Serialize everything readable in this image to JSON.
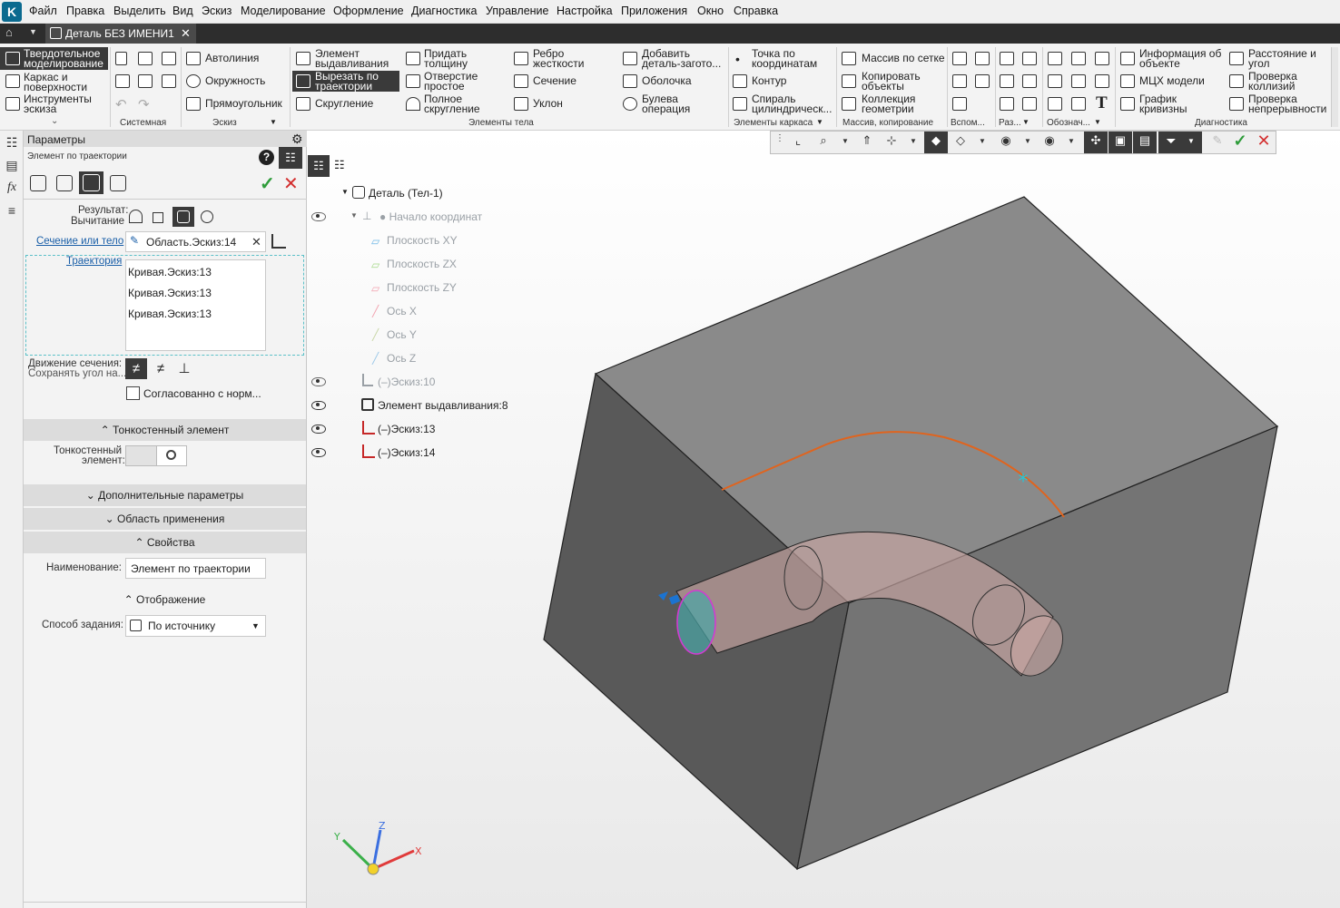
{
  "menu": [
    "Файл",
    "Правка",
    "Выделить",
    "Вид",
    "Эскиз",
    "Моделирование",
    "Оформление",
    "Диагностика",
    "Управление",
    "Настройка",
    "Приложения",
    "Окно",
    "Справка"
  ],
  "document_tab": "Деталь БЕЗ ИМЕНИ1",
  "ribbon": {
    "modes": [
      "Твердотельное моделирование",
      "Каркас и поверхности",
      "Инструменты эскиза"
    ],
    "sketch": [
      "Автолиния",
      "Окружность",
      "Прямоугольник"
    ],
    "body1": [
      "Элемент выдавливания",
      "Вырезать по траектории",
      "Скругление"
    ],
    "body2": [
      "Придать толщину",
      "Отверстие простое",
      "Полное скругление"
    ],
    "body3": [
      "Ребро жесткости",
      "Сечение",
      "Уклон"
    ],
    "body4": [
      "Добавить деталь-загото...",
      "Оболочка",
      "Булева операция"
    ],
    "frame": [
      "Точка по координатам",
      "Контур",
      "Спираль цилиндрическ..."
    ],
    "array": [
      "Массив по сетке",
      "Копировать объекты",
      "Коллекция геометрии"
    ],
    "info": [
      "Информация об объекте",
      "МЦХ модели",
      "График кривизны"
    ],
    "check": [
      "Расстояние и угол",
      "Проверка коллизий",
      "Проверка непрерывности"
    ],
    "groups": [
      "Системная",
      "Эскиз",
      "Элементы тела",
      "Элементы каркаса",
      "Массив, копирование",
      "Вспом...",
      "Раз...",
      "Обознач...",
      "Диагностика"
    ]
  },
  "panel": {
    "title": "Параметры",
    "subtitle": "Элемент по траектории",
    "result_label": "Результат:",
    "result_value": "Вычитание",
    "section_label": "Сечение или тело",
    "section_value": "Область.Эскиз:14",
    "trajectory_label": "Траектория",
    "trajectory_items": [
      "Кривая.Эскиз:13",
      "Кривая.Эскиз:13",
      "Кривая.Эскиз:13"
    ],
    "motion_label": "Движение сечения:",
    "motion_value": "Сохранять угол на...",
    "checkbox_label": "Согласованно с норм...",
    "thin_section": "Тонкостенный элемент",
    "thin_label_1": "Тонкостенный",
    "thin_label_2": "элемент:",
    "extra_section": "Дополнительные параметры",
    "scope_section": "Область применения",
    "props_section": "Свойства",
    "name_label": "Наименование:",
    "name_value": "Элемент по траектории",
    "display_section": "Отображение",
    "method_label": "Способ задания:",
    "method_value": "По источнику"
  },
  "tree": {
    "root": "Деталь (Тел-1)",
    "origin": "Начало координат",
    "planes": [
      "Плоскость XY",
      "Плоскость ZX",
      "Плоскость ZY"
    ],
    "axes": [
      "Ось X",
      "Ось Y",
      "Ось Z"
    ],
    "items": [
      "Эскиз:10",
      "Элемент выдавливания:8",
      "Эскиз:13",
      "Эскиз:14"
    ]
  },
  "axes_labels": {
    "x": "X",
    "y": "Y",
    "z": "Z"
  },
  "colors": {
    "accent": "#e0641e",
    "ok": "#2e9c3a",
    "cancel": "#d32f2f",
    "dark_ui": "#2d2d2d"
  }
}
